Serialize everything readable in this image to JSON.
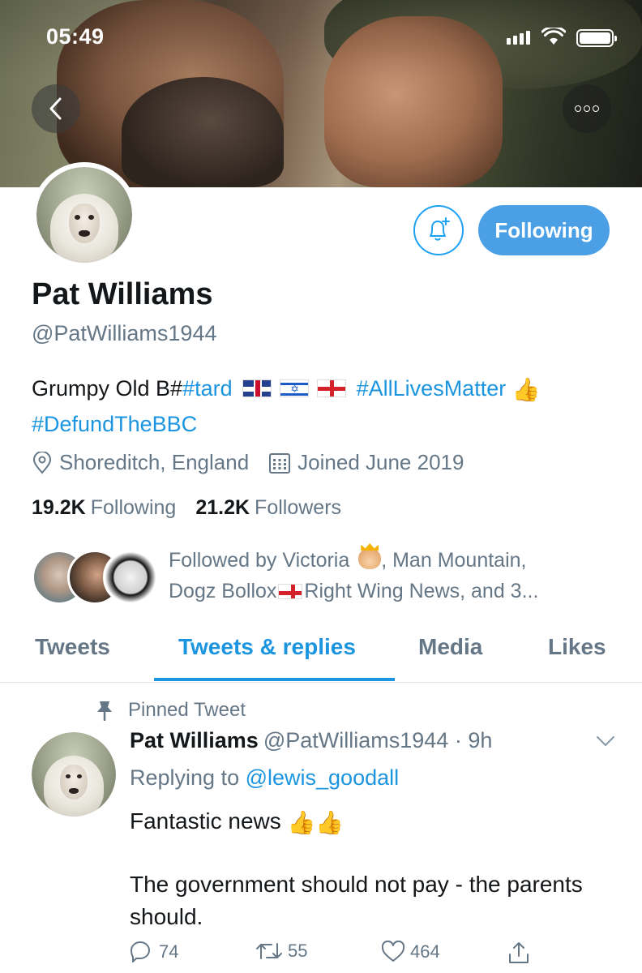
{
  "status_bar": {
    "time": "05:49"
  },
  "profile": {
    "name": "Pat Williams",
    "handle": "@PatWilliams1944",
    "bio_prefix": "Grumpy Old B#",
    "bio_tag1": "#tard",
    "bio_tag2": "#AllLivesMatter",
    "bio_tag3": "#DefundTheBBC",
    "location": "Shoreditch, England",
    "joined": "Joined June 2019",
    "following_count": "19.2K",
    "following_label": "Following",
    "followers_count": "21.2K",
    "followers_label": "Followers",
    "follow_button": "Following",
    "followed_by_line1": "Followed by Victoria",
    "followed_by_line1b": ", Man Mountain,",
    "followed_by_line2a": "Dogz Bollox",
    "followed_by_line2b": "Right Wing News, and 3..."
  },
  "tabs": [
    "Tweets",
    "Tweets & replies",
    "Media",
    "Likes"
  ],
  "active_tab": "Tweets & replies",
  "tweet": {
    "pinned_label": "Pinned Tweet",
    "author_name": "Pat Williams",
    "author_handle": "@PatWilliams1944",
    "time": "· 9h",
    "replying_prefix": "Replying to",
    "replying_to": "@lewis_goodall",
    "text_line1": "Fantastic news",
    "text_line2": "The government should not pay - the parents should.",
    "replies": "74",
    "retweets": "55",
    "likes": "464"
  },
  "icons": {
    "back": "chevron-left-icon",
    "more": "more-icon",
    "bell": "bell-plus-icon",
    "location": "location-pin-icon",
    "calendar": "calendar-icon",
    "pin": "pin-icon",
    "reply": "reply-icon",
    "retweet": "retweet-icon",
    "like": "heart-icon",
    "share": "share-icon"
  },
  "colors": {
    "accent": "#1b95e0",
    "button": "#4a9fe5",
    "muted": "#657786"
  }
}
